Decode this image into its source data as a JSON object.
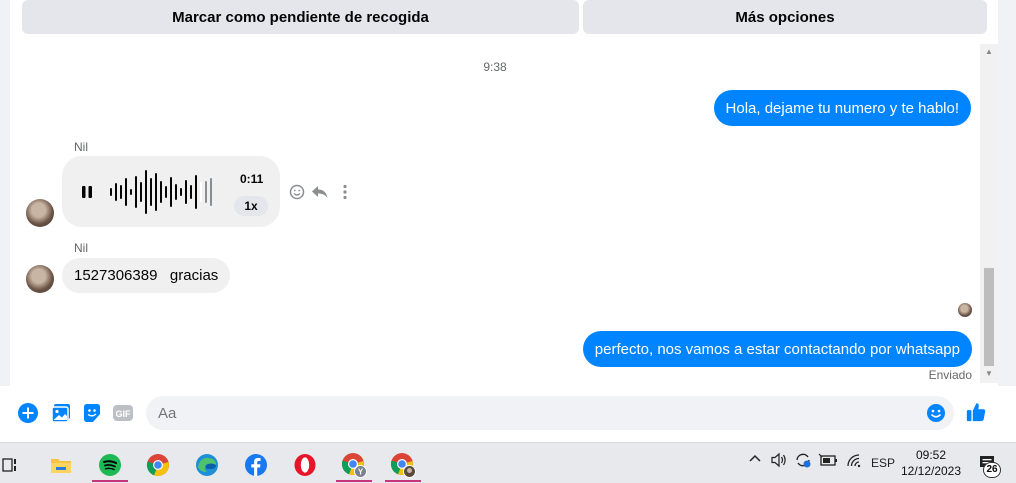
{
  "top_actions": {
    "mark_pending_label": "Marcar como pendiente de recogida",
    "more_options_label": "Más opciones"
  },
  "conversation": {
    "timestamp": "9:38",
    "messages": [
      {
        "direction": "out",
        "text": "Hola, dejame tu numero y te hablo!"
      },
      {
        "direction": "in",
        "sender": "Nil",
        "type": "audio",
        "duration": "0:11",
        "speed": "1x"
      },
      {
        "direction": "in",
        "sender": "Nil",
        "text": "1527306389   gracias"
      },
      {
        "direction": "out",
        "text": "perfecto, nos vamos a estar contactando por whatsapp"
      }
    ],
    "status_label": "Enviado"
  },
  "composer": {
    "placeholder": "Aa"
  },
  "taskbar": {
    "apps": [
      "task-view",
      "file-explorer",
      "spotify",
      "chrome",
      "edge",
      "facebook",
      "opera",
      "chrome-profile-y",
      "chrome-profile-2"
    ],
    "tray": {
      "language": "ESP",
      "time": "09:52",
      "date": "12/12/2023",
      "notification_count": "26"
    }
  },
  "colors": {
    "accent": "#0084ff",
    "incoming_bubble": "#f0f0f0",
    "top_button_bg": "#e4e6eb"
  }
}
